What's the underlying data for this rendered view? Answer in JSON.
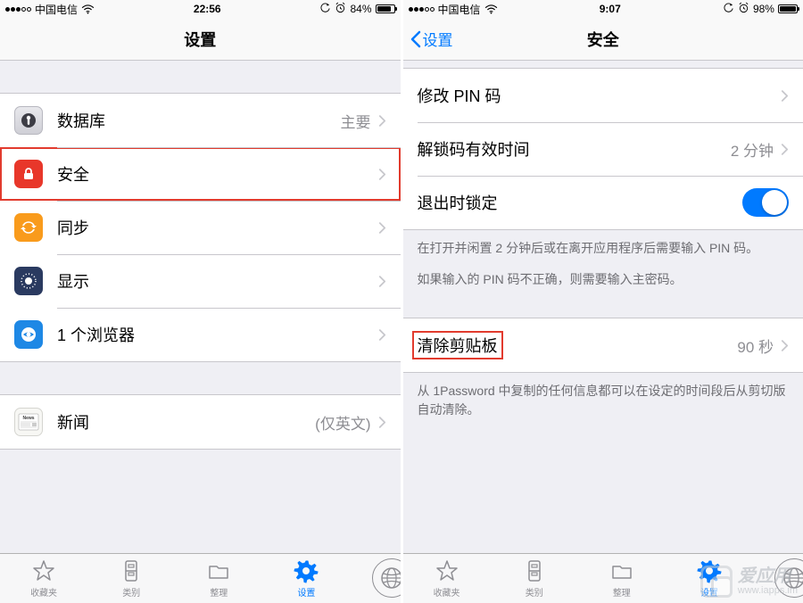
{
  "left": {
    "status": {
      "carrier": "中国电信",
      "time": "22:56",
      "batteryPct": "84%",
      "batteryFill": 84
    },
    "nav": {
      "title": "设置"
    },
    "group1": [
      {
        "icon": "database",
        "label": "数据库",
        "detail": "主要"
      },
      {
        "icon": "lock",
        "label": "安全",
        "detail": "",
        "highlightRow": true
      },
      {
        "icon": "sync",
        "label": "同步",
        "detail": ""
      },
      {
        "icon": "display",
        "label": "显示",
        "detail": ""
      },
      {
        "icon": "browser",
        "label": "1 个浏览器",
        "detail": ""
      }
    ],
    "group2": [
      {
        "icon": "news",
        "label": "新闻",
        "detail": "(仅英文)"
      }
    ],
    "tabs": [
      {
        "label": "收藏夹",
        "icon": "star"
      },
      {
        "label": "类别",
        "icon": "categories"
      },
      {
        "label": "整理",
        "icon": "folder"
      },
      {
        "label": "设置",
        "icon": "gear",
        "active": true
      },
      {
        "label": "",
        "icon": "globe"
      }
    ]
  },
  "right": {
    "status": {
      "carrier": "中国电信",
      "time": "9:07",
      "batteryPct": "98%",
      "batteryFill": 98
    },
    "nav": {
      "title": "安全",
      "back": "设置"
    },
    "secGroup": [
      {
        "label": "修改 PIN 码",
        "detail": ""
      },
      {
        "label": "解锁码有效时间",
        "detail": "2 分钟"
      },
      {
        "label": "退出时锁定",
        "toggle": true
      }
    ],
    "secFooter1": "在打开并闲置 2 分钟后或在离开应用程序后需要输入 PIN 码。",
    "secFooter2": "如果输入的 PIN 码不正确，则需要输入主密码。",
    "clipGroup": [
      {
        "label": "清除剪贴板",
        "detail": "90 秒",
        "highlightLabel": true
      }
    ],
    "clipFooter": "从 1Password 中复制的任何信息都可以在设定的时间段后从剪切版自动清除。",
    "tabs": [
      {
        "label": "收藏夹",
        "icon": "star"
      },
      {
        "label": "类别",
        "icon": "categories"
      },
      {
        "label": "整理",
        "icon": "folder"
      },
      {
        "label": "设置",
        "icon": "gear",
        "active": true
      },
      {
        "label": "",
        "icon": "globe"
      }
    ]
  },
  "watermark": {
    "title": "爱应用",
    "url": "www.iapps.im"
  }
}
